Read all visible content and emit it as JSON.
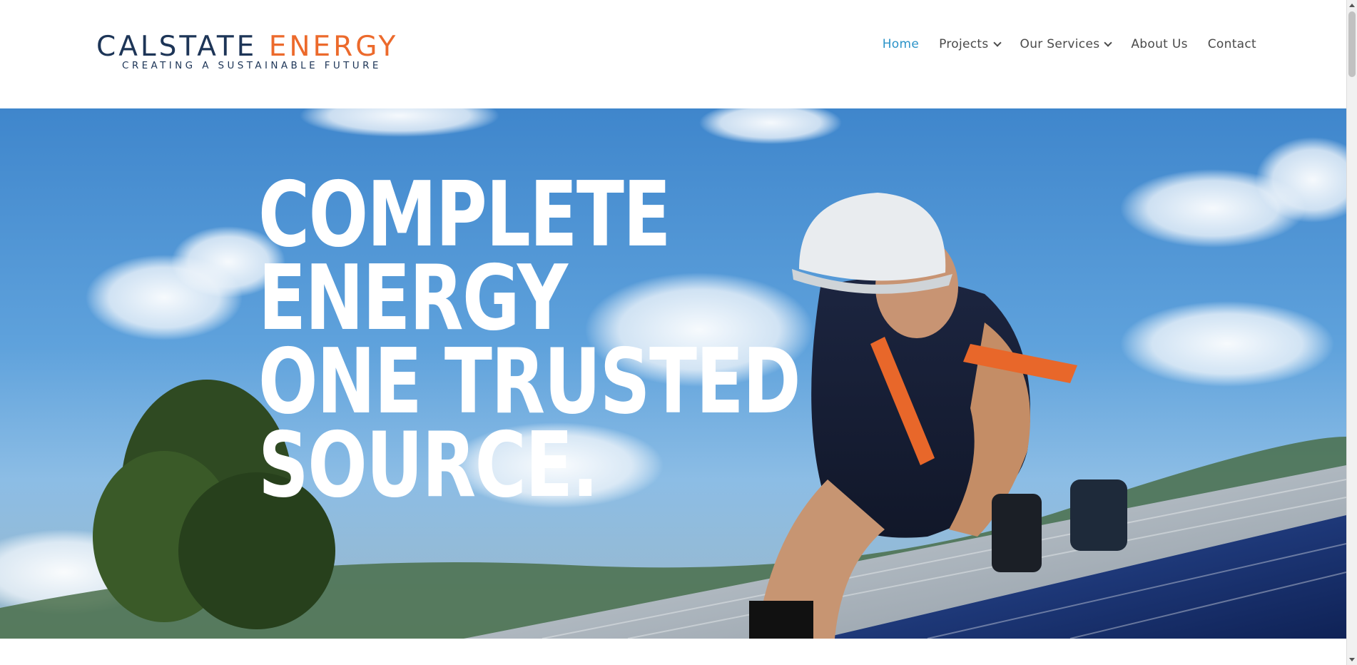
{
  "brand": {
    "name_part1": "CALSTATE ",
    "name_part2": "ENERGY",
    "tagline": "CREATING A SUSTAINABLE FUTURE",
    "primary_color": "#1d3557",
    "accent_color": "#ec6a2c"
  },
  "nav": {
    "items": [
      {
        "label": "Home",
        "active": true,
        "has_dropdown": false
      },
      {
        "label": "Projects",
        "active": false,
        "has_dropdown": true
      },
      {
        "label": "Our Services",
        "active": false,
        "has_dropdown": true
      },
      {
        "label": "About Us",
        "active": false,
        "has_dropdown": false
      },
      {
        "label": "Contact",
        "active": false,
        "has_dropdown": false
      }
    ],
    "active_color": "#2b93c8"
  },
  "hero": {
    "headline_lines": [
      "COMPLETE",
      "ENERGY",
      "ONE TRUSTED",
      "SOURCE."
    ],
    "image_icon": "solar-installer-photo"
  }
}
